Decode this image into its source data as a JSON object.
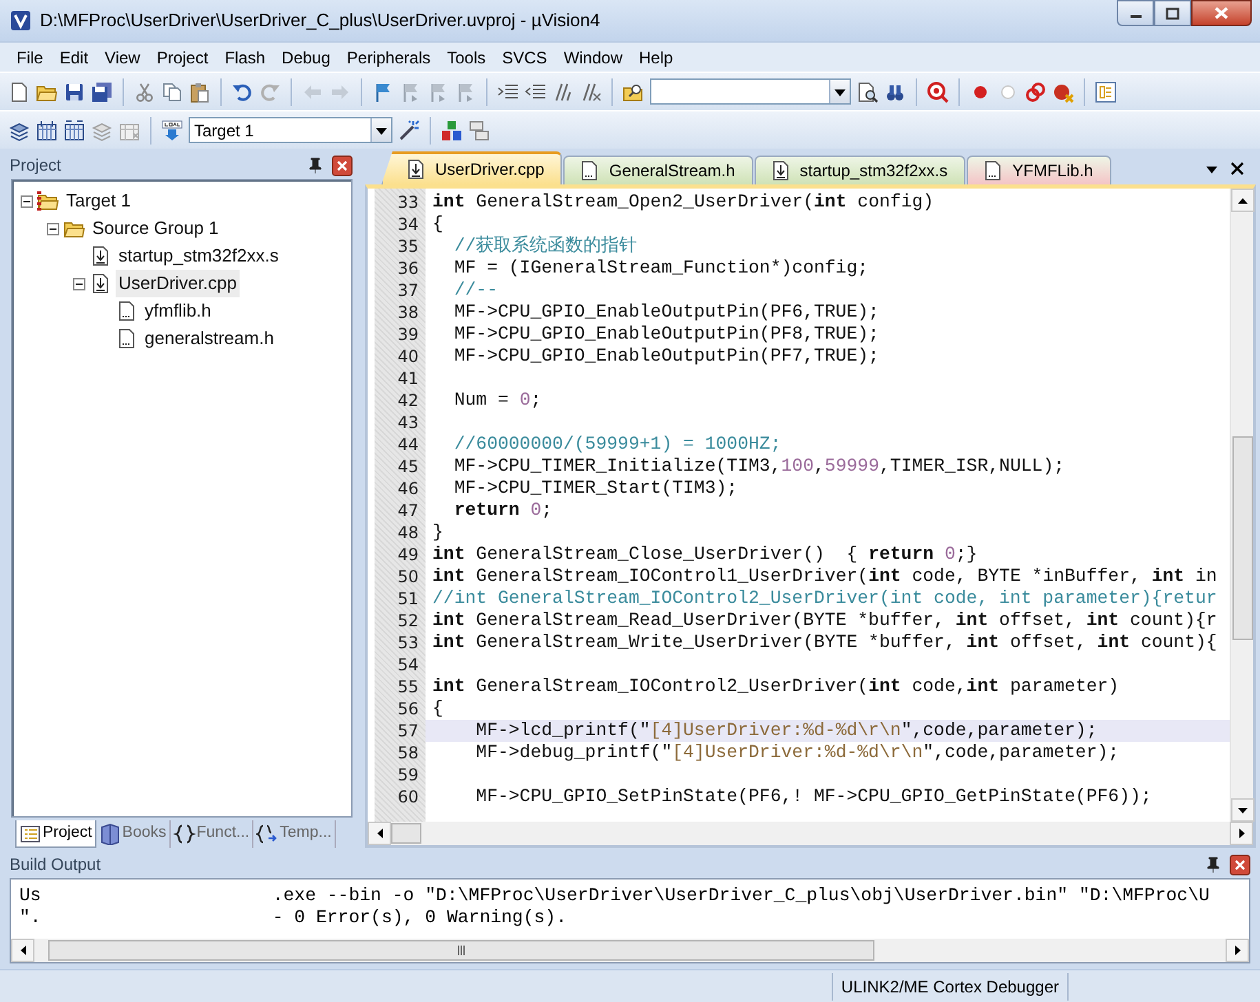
{
  "window": {
    "title": "D:\\MFProc\\UserDriver\\UserDriver_C_plus\\UserDriver.uvproj - µVision4"
  },
  "menu": [
    "File",
    "Edit",
    "View",
    "Project",
    "Flash",
    "Debug",
    "Peripherals",
    "Tools",
    "SVCS",
    "Window",
    "Help"
  ],
  "toolbar": {
    "target_combo": {
      "value": "Target 1"
    }
  },
  "project_panel": {
    "title": "Project",
    "tree": [
      {
        "label": "Target 1",
        "kind": "target",
        "expanded": true,
        "selected": false,
        "children": [
          {
            "label": "Source Group 1",
            "kind": "group",
            "expanded": true,
            "selected": false,
            "children": [
              {
                "label": "startup_stm32f2xx.s",
                "kind": "source",
                "selected": false
              },
              {
                "label": "UserDriver.cpp",
                "kind": "source",
                "expanded": true,
                "selected": true,
                "children": [
                  {
                    "label": "yfmflib.h",
                    "kind": "header",
                    "selected": false
                  },
                  {
                    "label": "generalstream.h",
                    "kind": "header",
                    "selected": false
                  }
                ]
              }
            ]
          }
        ]
      }
    ],
    "tabs": [
      {
        "label": "Project",
        "kind": "project",
        "selected": true
      },
      {
        "label": "Books",
        "kind": "books",
        "selected": false
      },
      {
        "label": "Funct...",
        "kind": "functions",
        "selected": false
      },
      {
        "label": "Temp...",
        "kind": "templates",
        "selected": false
      }
    ]
  },
  "editor": {
    "tabs": [
      {
        "label": "UserDriver.cpp",
        "kind": "source",
        "color": "#fbe08e",
        "selected": true
      },
      {
        "label": "GeneralStream.h",
        "kind": "header",
        "color": "#cfe2b6",
        "selected": false
      },
      {
        "label": "startup_stm32f2xx.s",
        "kind": "source",
        "color": "#cfe2b6",
        "selected": false
      },
      {
        "label": "YFMFLib.h",
        "kind": "header",
        "color": "#f4c4c6",
        "selected": false
      }
    ],
    "lines": [
      {
        "number": "33",
        "current": false,
        "tokens": [
          {
            "kind": "kw",
            "text": "int"
          },
          {
            "kind": "plain",
            "text": " GeneralStream_Open2_UserDriver("
          },
          {
            "kind": "kw",
            "text": "int"
          },
          {
            "kind": "plain",
            "text": " config)"
          }
        ]
      },
      {
        "number": "34",
        "current": false,
        "tokens": [
          {
            "kind": "plain",
            "text": "{"
          }
        ]
      },
      {
        "number": "35",
        "current": false,
        "tokens": [
          {
            "kind": "comment",
            "text": "  //获取系统函数的指针"
          }
        ]
      },
      {
        "number": "36",
        "current": false,
        "tokens": [
          {
            "kind": "plain",
            "text": "  MF = (IGeneralStream_Function*)config;"
          }
        ]
      },
      {
        "number": "37",
        "current": false,
        "tokens": [
          {
            "kind": "comment",
            "text": "  //--"
          }
        ]
      },
      {
        "number": "38",
        "current": false,
        "tokens": [
          {
            "kind": "plain",
            "text": "  MF->CPU_GPIO_EnableOutputPin(PF6,TRUE);"
          }
        ]
      },
      {
        "number": "39",
        "current": false,
        "tokens": [
          {
            "kind": "plain",
            "text": "  MF->CPU_GPIO_EnableOutputPin(PF8,TRUE);"
          }
        ]
      },
      {
        "number": "40",
        "current": false,
        "tokens": [
          {
            "kind": "plain",
            "text": "  MF->CPU_GPIO_EnableOutputPin(PF7,TRUE);"
          }
        ]
      },
      {
        "number": "41",
        "current": false
      },
      {
        "number": "42",
        "current": false,
        "tokens": [
          {
            "kind": "plain",
            "text": "  Num = "
          },
          {
            "kind": "num",
            "text": "0"
          },
          {
            "kind": "plain",
            "text": ";"
          }
        ]
      },
      {
        "number": "43",
        "current": false
      },
      {
        "number": "44",
        "current": false,
        "tokens": [
          {
            "kind": "comment",
            "text": "  //60000000/(59999+1) = 1000HZ;"
          }
        ]
      },
      {
        "number": "45",
        "current": false,
        "tokens": [
          {
            "kind": "plain",
            "text": "  MF->CPU_TIMER_Initialize(TIM3,"
          },
          {
            "kind": "num",
            "text": "100"
          },
          {
            "kind": "plain",
            "text": ","
          },
          {
            "kind": "num",
            "text": "59999"
          },
          {
            "kind": "plain",
            "text": ",TIMER_ISR,NULL);"
          }
        ]
      },
      {
        "number": "46",
        "current": false,
        "tokens": [
          {
            "kind": "plain",
            "text": "  MF->CPU_TIMER_Start(TIM3);"
          }
        ]
      },
      {
        "number": "47",
        "current": false,
        "tokens": [
          {
            "kind": "kw",
            "text": "  return"
          },
          {
            "kind": "num",
            "text": " 0"
          },
          {
            "kind": "plain",
            "text": ";"
          }
        ]
      },
      {
        "number": "48",
        "current": false,
        "tokens": [
          {
            "kind": "plain",
            "text": "}"
          }
        ]
      },
      {
        "number": "49",
        "current": false,
        "tokens": [
          {
            "kind": "kw",
            "text": "int"
          },
          {
            "kind": "plain",
            "text": " GeneralStream_Close_UserDriver()  { "
          },
          {
            "kind": "kw",
            "text": "return"
          },
          {
            "kind": "num",
            "text": " 0"
          },
          {
            "kind": "plain",
            "text": ";}"
          }
        ]
      },
      {
        "number": "50",
        "current": false,
        "tokens": [
          {
            "kind": "kw",
            "text": "int"
          },
          {
            "kind": "plain",
            "text": " GeneralStream_IOControl1_UserDriver("
          },
          {
            "kind": "kw",
            "text": "int"
          },
          {
            "kind": "plain",
            "text": " code, BYTE *inBuffer, "
          },
          {
            "kind": "kw",
            "text": "int"
          },
          {
            "kind": "plain",
            "text": " in"
          }
        ]
      },
      {
        "number": "51",
        "current": false,
        "tokens": [
          {
            "kind": "comment",
            "text": "//int GeneralStream_IOControl2_UserDriver(int code, int parameter){retur"
          }
        ]
      },
      {
        "number": "52",
        "current": false,
        "tokens": [
          {
            "kind": "kw",
            "text": "int"
          },
          {
            "kind": "plain",
            "text": " GeneralStream_Read_UserDriver(BYTE *buffer, "
          },
          {
            "kind": "kw",
            "text": "int"
          },
          {
            "kind": "plain",
            "text": " offset, "
          },
          {
            "kind": "kw",
            "text": "int"
          },
          {
            "kind": "plain",
            "text": " count){r"
          }
        ]
      },
      {
        "number": "53",
        "current": false,
        "tokens": [
          {
            "kind": "kw",
            "text": "int"
          },
          {
            "kind": "plain",
            "text": " GeneralStream_Write_UserDriver(BYTE *buffer, "
          },
          {
            "kind": "kw",
            "text": "int"
          },
          {
            "kind": "plain",
            "text": " offset, "
          },
          {
            "kind": "kw",
            "text": "int"
          },
          {
            "kind": "plain",
            "text": " count){"
          }
        ]
      },
      {
        "number": "54",
        "current": false
      },
      {
        "number": "55",
        "current": false,
        "tokens": [
          {
            "kind": "kw",
            "text": "int"
          },
          {
            "kind": "plain",
            "text": " GeneralStream_IOControl2_UserDriver("
          },
          {
            "kind": "kw",
            "text": "int"
          },
          {
            "kind": "plain",
            "text": " code,"
          },
          {
            "kind": "kw",
            "text": "int"
          },
          {
            "kind": "plain",
            "text": " parameter)"
          }
        ]
      },
      {
        "number": "56",
        "current": false,
        "tokens": [
          {
            "kind": "plain",
            "text": "{"
          }
        ]
      },
      {
        "number": "57",
        "current": true,
        "tokens": [
          {
            "kind": "plain",
            "text": "    MF->lcd_printf(\""
          },
          {
            "kind": "str",
            "text": "[4]UserDriver:%d-%d\\r\\n"
          },
          {
            "kind": "plain",
            "text": "\",code,parameter);"
          }
        ]
      },
      {
        "number": "58",
        "current": false,
        "tokens": [
          {
            "kind": "plain",
            "text": "    MF->debug_printf(\""
          },
          {
            "kind": "str",
            "text": "[4]UserDriver:%d-%d\\r\\n"
          },
          {
            "kind": "plain",
            "text": "\",code,parameter);"
          }
        ]
      },
      {
        "number": "59",
        "current": false
      },
      {
        "number": "60",
        "current": false,
        "tokens": [
          {
            "kind": "plain",
            "text": "    MF->CPU_GPIO_SetPinState(PF6,! MF->CPU_GPIO_GetPinState(PF6));"
          }
        ]
      }
    ]
  },
  "build_output": {
    "title": "Build Output",
    "lines": [
      {
        "start": "Us",
        "rest": ".exe --bin -o \"D:\\MFProc\\UserDriver\\UserDriver_C_plus\\obj\\UserDriver.bin\" \"D:\\MFProc\\U"
      },
      {
        "start": "\".",
        "rest": "- 0 Error(s), 0 Warning(s)."
      }
    ]
  },
  "status_bar": {
    "debugger": "ULINK2/ME Cortex Debugger"
  }
}
